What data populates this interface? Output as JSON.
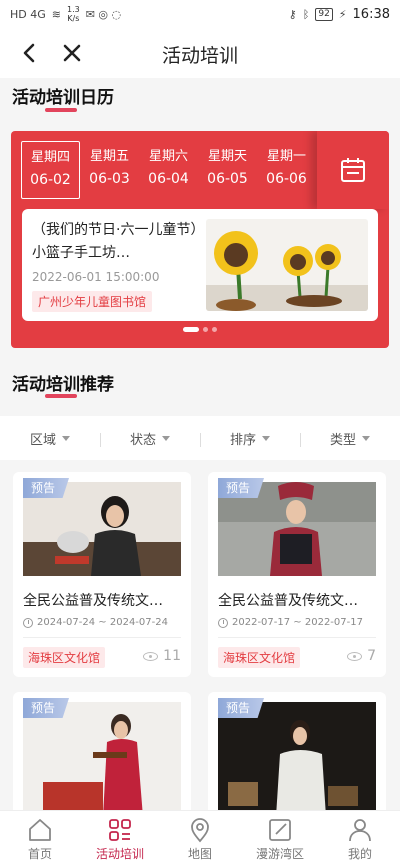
{
  "status_bar": {
    "left_icons": "HD 4G",
    "speed_value": "1.3",
    "speed_unit": "K/s",
    "battery": "92",
    "time": "16:38"
  },
  "header": {
    "title": "活动培训"
  },
  "calendar_section": {
    "title": "活动培训日历",
    "days": [
      {
        "weekday": "星期四",
        "date": "06-02",
        "selected": true
      },
      {
        "weekday": "星期五",
        "date": "06-03"
      },
      {
        "weekday": "星期六",
        "date": "06-04"
      },
      {
        "weekday": "星期天",
        "date": "06-05"
      },
      {
        "weekday": "星期一",
        "date": "06-06"
      }
    ],
    "event": {
      "title": "（我们的节日·六一儿童节）小篮子手工坊…",
      "time": "2022-06-01 15:00:00",
      "library": "广州少年儿童图书馆"
    }
  },
  "recommend_section": {
    "title": "活动培训推荐"
  },
  "filters": [
    "区域",
    "状态",
    "排序",
    "类型"
  ],
  "activities": [
    {
      "tag": "预告",
      "title": "全民公益普及传统文…",
      "date": "2024-07-24 ~ 2024-07-24",
      "library": "海珠区文化馆",
      "views": "11"
    },
    {
      "tag": "预告",
      "title": "全民公益普及传统文…",
      "date": "2022-07-17 ~ 2022-07-17",
      "library": "海珠区文化馆",
      "views": "7"
    },
    {
      "tag": "预告"
    },
    {
      "tag": "预告"
    }
  ],
  "tabbar": [
    "首页",
    "活动培训",
    "地图",
    "漫游湾区",
    "我的"
  ],
  "colors": {
    "accent": "#e33d42",
    "tab_active": "#c4264d"
  }
}
